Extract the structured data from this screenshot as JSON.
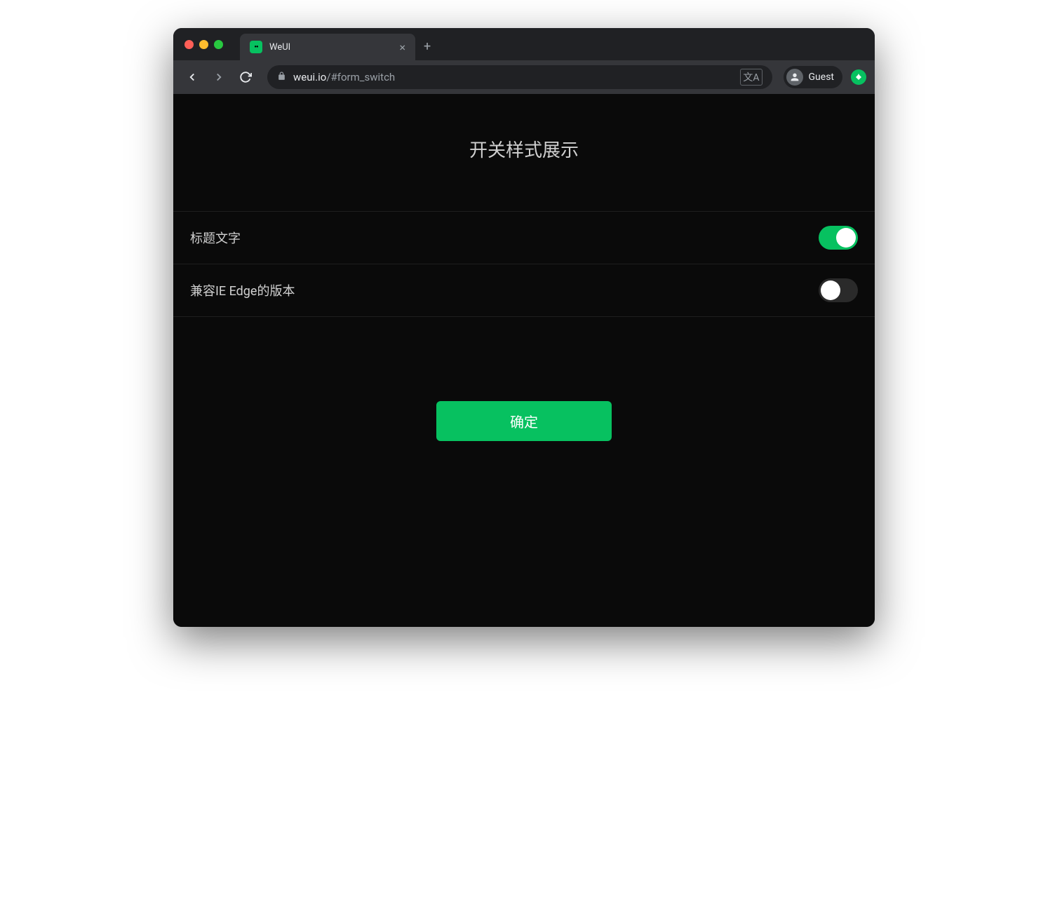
{
  "browser": {
    "tab_title": "WeUI",
    "url_host": "weui.io",
    "url_path": "/#form_switch",
    "profile_label": "Guest"
  },
  "page": {
    "title": "开关样式展示",
    "rows": [
      {
        "label": "标题文字",
        "on": true
      },
      {
        "label": "兼容IE Edge的版本",
        "on": false
      }
    ],
    "submit_label": "确定"
  },
  "colors": {
    "accent": "#07c160",
    "window_bg": "#202124",
    "content_bg": "#0a0a0a"
  }
}
